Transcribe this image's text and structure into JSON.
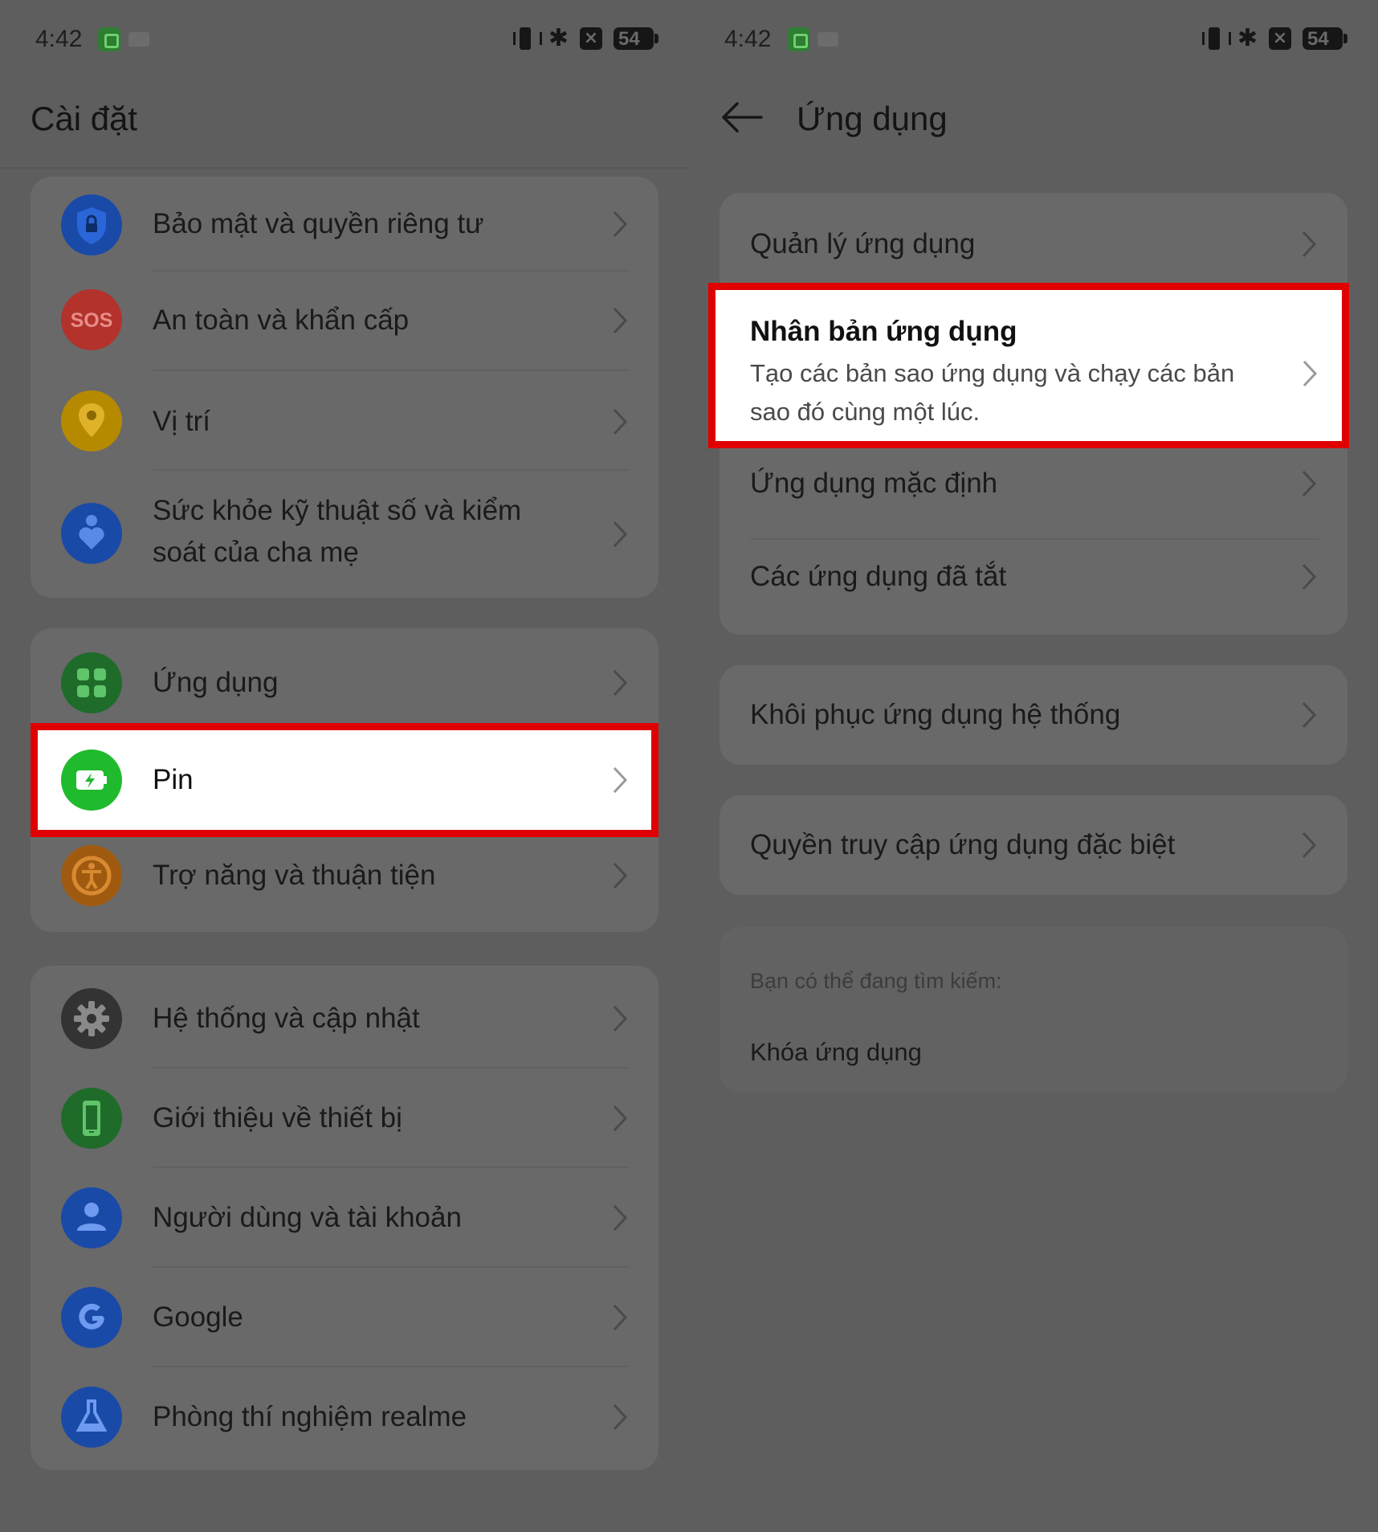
{
  "status_bar": {
    "time": "4:42",
    "battery": "54",
    "icons": [
      "app-icon",
      "notification-icon",
      "vibrate-icon",
      "bluetooth-icon",
      "x-icon",
      "battery-icon"
    ]
  },
  "left": {
    "title": "Cài đặt",
    "groups": [
      {
        "items": [
          {
            "label": "Bảo mật và quyền riêng tư",
            "icon": "shield-lock-icon",
            "color": "#1a4aa8"
          },
          {
            "label": "An toàn và khẩn cấp",
            "icon": "sos-icon",
            "color": "#b3322c"
          },
          {
            "label": "Vị trí",
            "icon": "location-pin-icon",
            "color": "#b58a00"
          },
          {
            "label_line1": "Sức khỏe kỹ thuật số và kiểm",
            "label_line2": "soát của cha mẹ",
            "icon": "heart-person-icon",
            "color": "#1a4aa8"
          }
        ]
      },
      {
        "items": [
          {
            "label": "Ứng dụng",
            "icon": "apps-grid-icon",
            "color": "#1f6b2a"
          },
          {
            "label": "Pin",
            "icon": "battery-charge-icon",
            "color": "#1fba2d",
            "highlighted": true
          },
          {
            "label": "Trợ năng và thuận tiện",
            "icon": "accessibility-icon",
            "color": "#a05a10"
          }
        ]
      },
      {
        "items": [
          {
            "label": "Hệ thống và cập nhật",
            "icon": "gear-icon",
            "color": "#333333"
          },
          {
            "label": "Giới thiệu về thiết bị",
            "icon": "phone-icon",
            "color": "#1f6b2a"
          },
          {
            "label": "Người dùng và tài khoản",
            "icon": "user-icon",
            "color": "#1a4aa8"
          },
          {
            "label": "Google",
            "icon": "google-icon",
            "color": "#1a4aa8"
          },
          {
            "label": "Phòng thí nghiệm realme",
            "icon": "flask-icon",
            "color": "#1a4aa8"
          }
        ]
      }
    ]
  },
  "right": {
    "title": "Ứng dụng",
    "group1": [
      {
        "label": "Quản lý ứng dụng"
      },
      {
        "label": "Nhân bản ứng dụng",
        "sub_line1": "Tạo các bản sao ứng dụng và chạy các bản",
        "sub_line2": "sao đó cùng một lúc.",
        "highlighted": true
      },
      {
        "label": "Ứng dụng mặc định"
      },
      {
        "label": "Các ứng dụng đã tắt"
      }
    ],
    "group2": [
      {
        "label": "Khôi phục ứng dụng hệ thống"
      }
    ],
    "group3": [
      {
        "label": "Quyền truy cập ứng dụng đặc biệt"
      }
    ],
    "suggest": {
      "heading": "Bạn có thể đang tìm kiếm:",
      "item": "Khóa ứng dụng"
    }
  },
  "colors": {
    "highlight_border": "#e00000",
    "dim_background": "#5e5e5e",
    "card": "#696969"
  }
}
